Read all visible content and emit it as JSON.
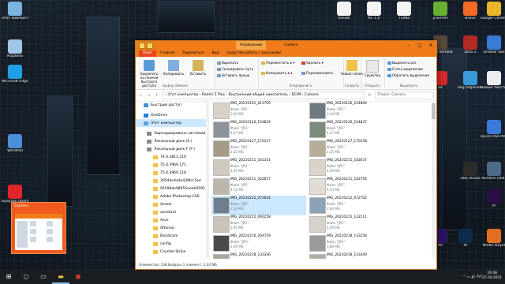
{
  "desktop_left": [
    {
      "label": "Этот компьютер",
      "icon": "computer-icon",
      "color": "#7ab3e0"
    },
    {
      "label": "Корзина",
      "icon": "recycle-bin-icon",
      "color": "#9fc6e8"
    },
    {
      "label": "Microsoft Edge",
      "icon": "edge-icon",
      "color": "#1fa0e6"
    },
    {
      "label": "WordPad",
      "icon": "wordpad-icon",
      "color": "#4a8fd8"
    },
    {
      "label": "Браузер Opera",
      "icon": "opera-icon",
      "color": "#e0262a"
    }
  ],
  "desktop_right": [
    {
      "label": "Юнюб",
      "icon": "file-icon",
      "color": "#f4f4f4"
    },
    {
      "label": "КС 1.6",
      "icon": "file-icon",
      "color": "#f4f4f4"
    },
    {
      "label": "ТЕМЫ",
      "icon": "file-icon",
      "color": "#f4f4f4"
    },
    {
      "label": "µTorrent",
      "icon": "utorrent-icon",
      "color": "#67b032"
    },
    {
      "label": "Brave",
      "icon": "brave-icon",
      "color": "#f26a24"
    },
    {
      "label": "Google Chrome",
      "icon": "chrome-icon",
      "color": "#e9b62a"
    },
    {
      "label": "Mortal Kombat 4",
      "icon": "game-icon",
      "color": "#5a4a38"
    },
    {
      "label": "Dota 2",
      "icon": "dota-icon",
      "color": "#b22a22"
    },
    {
      "label": "Unistall Tool",
      "icon": "uninstall-icon",
      "color": "#3a7bd5"
    },
    {
      "label": "64",
      "icon": "aida-icon",
      "color": "#d8282a"
    },
    {
      "label": "Reg Organizer",
      "icon": "reg-icon",
      "color": "#3a9ad9"
    },
    {
      "label": "Новый текстов...",
      "icon": "text-file-icon",
      "color": "#eeeeee"
    },
    {
      "label": "QuickTime Player",
      "icon": "quicktime-icon",
      "color": "#3b7ad8"
    },
    {
      "label": "OBS Studio",
      "icon": "obs-icon",
      "color": "#2c2c2c"
    },
    {
      "label": "REAPER (x64)",
      "icon": "reaper-icon",
      "color": "#4d6a86"
    },
    {
      "label": "Ae",
      "icon": "ae-icon",
      "color": "#2a1460"
    },
    {
      "label": "Ps",
      "icon": "ps-icon",
      "color": "#0f2b4c"
    },
    {
      "label": "Pr",
      "icon": "pr-icon",
      "color": "#2a0e44"
    },
    {
      "label": "Media Player",
      "icon": "media-icon",
      "color": "#e37021"
    }
  ],
  "window": {
    "context_tab": "Управление",
    "title": "Camera",
    "tabs": [
      "Файл",
      "Главная",
      "Поделиться",
      "Вид",
      "Средства работы с рисунками"
    ],
    "ribbon": {
      "pin": "Закрепить на панели быстрого доступа",
      "copy": "Копировать",
      "paste": "Вставить",
      "cut": "Вырезать",
      "copy_path": "Скопировать путь",
      "paste_shortcut": "Вставить ярлык",
      "clipboard_group": "Буфер обмена",
      "move_to": "Переместить в ▾",
      "copy_to": "Копировать в ▾",
      "delete": "Удалить ▾",
      "rename": "Переименовать",
      "organize_group": "Упорядочить",
      "new_folder": "Новая папка",
      "new_group": "Создать",
      "properties": "Свойства",
      "open_group": "Открыть",
      "select_all": "Выделить все",
      "select_none": "Снять выделение",
      "invert": "Обратить выделение",
      "select_group": "Выделить"
    },
    "path": "›  Этот компьютер  ›  Redmi 5 Plus  ›  Внутренний общий накопитель  ›  DCIM  ›  Camera",
    "search_placeholder": "Поиск: Camera",
    "nav_items": [
      {
        "label": "Быстрый доступ",
        "icon": "star-icon",
        "color": "#3d8fd6"
      },
      {
        "label": "OneDrive",
        "icon": "cloud-icon",
        "color": "#2a7bd6"
      },
      {
        "label": "Этот компьютер",
        "icon": "computer-icon",
        "color": "#5aa0e0",
        "selected": true
      },
      {
        "label": "Зарезервировано системой",
        "icon": "drive-icon",
        "color": "#8a8a8a"
      },
      {
        "label": "Локальный диск (E:)",
        "icon": "drive-icon",
        "color": "#8a8a8a"
      },
      {
        "label": "Локальный диск F (F:)",
        "icon": "drive-icon",
        "color": "#8a8a8a"
      },
      {
        "label": "74.0.3811.210",
        "icon": "folder-icon",
        "color": "#f0c24a"
      },
      {
        "label": "75.0.3969.171",
        "icon": "folder-icon",
        "color": "#f0c24a"
      },
      {
        "label": "75.0.3969.218",
        "icon": "folder-icon",
        "color": "#f0c24a"
      },
      {
        "label": "3054de4a4e43f8cc5ee",
        "icon": "folder-icon",
        "color": "#f0c24a"
      },
      {
        "label": "95598de98955eede9595",
        "icon": "folder-icon",
        "color": "#f0c24a"
      },
      {
        "label": "Adobe Photoshop CS6",
        "icon": "folder-icon",
        "color": "#f0c24a"
      },
      {
        "label": "Assets",
        "icon": "folder-icon",
        "color": "#f0c24a"
      },
      {
        "label": "assistant",
        "icon": "folder-icon",
        "color": "#f0c24a"
      },
      {
        "label": "Asus",
        "icon": "folder-icon",
        "color": "#f0c24a"
      },
      {
        "label": "Attanoic",
        "icon": "folder-icon",
        "color": "#f0c24a"
      },
      {
        "label": "Bandicam",
        "icon": "folder-icon",
        "color": "#f0c24a"
      },
      {
        "label": "config",
        "icon": "folder-icon",
        "color": "#f0c24a"
      },
      {
        "label": "Counter-Strike",
        "icon": "folder-icon",
        "color": "#f0c24a"
      }
    ],
    "files": [
      {
        "name": "IMG_20210101_011709",
        "type": "Файл \"JPG\"",
        "size": "3,93 МБ",
        "color": "#d9d2c8"
      },
      {
        "name": "IMG_20210120_154806",
        "type": "Файл \"JPG\"",
        "size": "3,04 МБ",
        "color": "#6f7a82"
      },
      {
        "name": "IMG_20210120_154829",
        "type": "Файл \"JPG\"",
        "size": "4,47 МБ",
        "color": "#8b949b"
      },
      {
        "name": "IMG_20210120_154837",
        "type": "Файл \"JPG\"",
        "size": "4,47 МБ",
        "color": "#7d8a7e"
      },
      {
        "name": "IMG_20210127_170157",
        "type": "Файл \"JPG\"",
        "size": "2,32 МБ",
        "color": "#a69b86"
      },
      {
        "name": "IMG_20210127_170158",
        "type": "Файл \"JPG\"",
        "size": "2,35 МБ",
        "color": "#b7ad98"
      },
      {
        "name": "IMG_20210211_161331",
        "type": "Файл \"JPG\"",
        "size": "4,06 МБ",
        "color": "#cfc9c0"
      },
      {
        "name": "IMG_20210211_162637",
        "type": "Файл \"JPG\"",
        "size": "4,09 МБ",
        "color": "#dad4cb"
      },
      {
        "name": "IMG_20210211_162657",
        "type": "Файл \"JPG\"",
        "size": "4,16 МБ",
        "color": "#bdb6aa"
      },
      {
        "name": "IMG_20210211_162754",
        "type": "Файл \"JPG\"",
        "size": "4,53 МБ",
        "color": "#e2ddd4"
      },
      {
        "name": "IMG_20210212_072654",
        "type": "Файл \"JPG\"",
        "size": "2,34 МБ",
        "color": "#6b7f90",
        "selected": true
      },
      {
        "name": "IMG_20210212_072702",
        "type": "Файл \"JPG\"",
        "size": "2,60 МБ",
        "color": "#8aa3b8"
      },
      {
        "name": "IMG_20210212_092258",
        "type": "Файл \"JPG\"",
        "size": "2,95 МБ",
        "color": "#c9c3b8"
      },
      {
        "name": "IMG_20210215_122111",
        "type": "Файл \"JPG\"",
        "size": "4,29 МБ",
        "color": "#d7d3cc"
      },
      {
        "name": "IMG_20210216_204759",
        "type": "Файл \"JPG\"",
        "size": "2,06 МБ",
        "color": "#4a4a4a"
      },
      {
        "name": "IMG_20210218_133158",
        "type": "Файл \"JPG\"",
        "size": "3,89 МБ",
        "color": "#9a9a9a"
      },
      {
        "name": "IMG_20210218_133336",
        "type": "Файл \"JPG\"",
        "size": "3,82 МБ",
        "color": "#a9a59d"
      },
      {
        "name": "IMG_20210218_133349",
        "type": "Файл \"JPG\"",
        "size": "3,81 МБ",
        "color": "#b2ada3"
      }
    ],
    "status": "Элементов: 138    Выбран 1 элемент: 2,34 МБ"
  },
  "preview": {
    "title": "Camera"
  },
  "taskbar": {
    "tray_text": "^  ▭  🔊  РУС",
    "time": "16:48",
    "date": "27.04.2021"
  }
}
